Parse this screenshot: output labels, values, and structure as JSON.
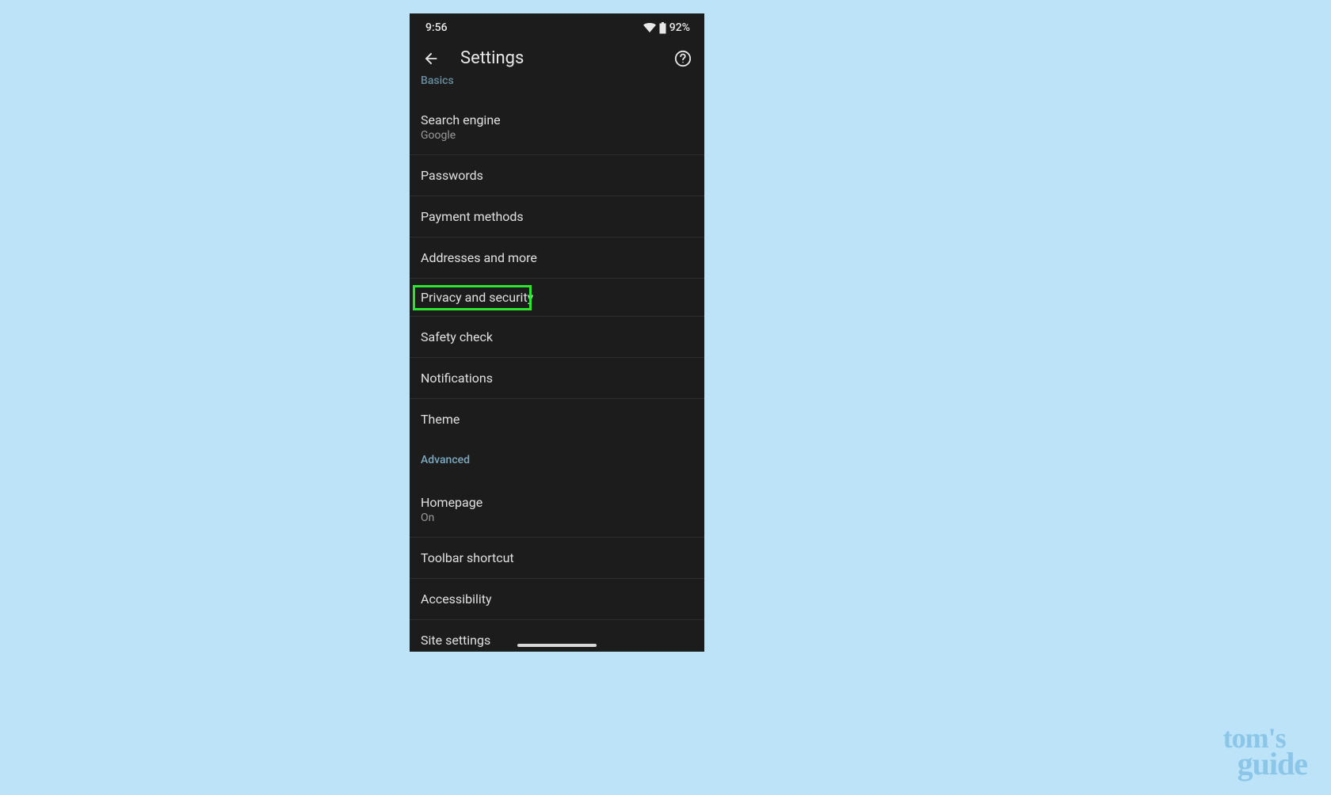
{
  "status": {
    "time": "9:56",
    "battery_percent": "92%"
  },
  "appbar": {
    "title": "Settings"
  },
  "sections": {
    "basics_header": "Basics",
    "advanced_header": "Advanced"
  },
  "items": {
    "search_engine": {
      "title": "Search engine",
      "subtitle": "Google"
    },
    "passwords": {
      "title": "Passwords"
    },
    "payment_methods": {
      "title": "Payment methods"
    },
    "addresses": {
      "title": "Addresses and more"
    },
    "privacy": {
      "title": "Privacy and security"
    },
    "safety_check": {
      "title": "Safety check"
    },
    "notifications": {
      "title": "Notifications"
    },
    "theme": {
      "title": "Theme"
    },
    "homepage": {
      "title": "Homepage",
      "subtitle": "On"
    },
    "toolbar_shortcut": {
      "title": "Toolbar shortcut"
    },
    "accessibility": {
      "title": "Accessibility"
    },
    "site_settings": {
      "title": "Site settings"
    }
  },
  "watermark": {
    "line1": "tom's",
    "line2": "guide"
  }
}
